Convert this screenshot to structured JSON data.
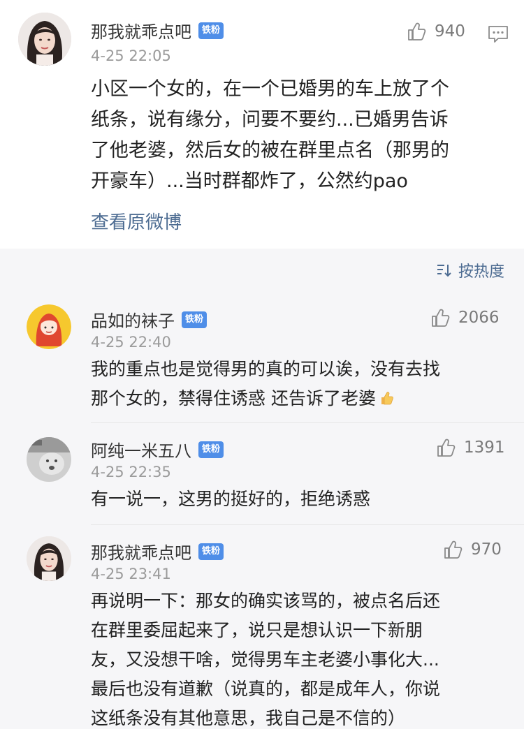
{
  "top_comment": {
    "username": "那我就乖点吧",
    "badge": "铁粉",
    "likes": "940",
    "timestamp": "4-25 22:05",
    "text_lines": [
      "小区一个女的，在一个已婚男的车上放了个",
      "纸条，说有缘分，问要不要约...已婚男告诉",
      "了他老婆，然后女的被在群里点名（那男的",
      "开豪车）...当时群都炸了，公然约pao"
    ],
    "view_original": "查看原微博",
    "more_icon": "comment-more-icon"
  },
  "sort": {
    "label": "按热度",
    "icon": "sort-icon"
  },
  "replies": [
    {
      "username": "品如的袜子",
      "badge": "铁粉",
      "likes": "2066",
      "timestamp": "4-25 22:40",
      "text_lines": [
        "我的重点也是觉得男的真的可以诶，没有去找",
        "那个女的，禁得住诱惑 还告诉了老婆"
      ],
      "trailing_emoji": "thumbs-up-emoji"
    },
    {
      "username": "阿纯一米五八",
      "badge": "铁粉",
      "likes": "1391",
      "timestamp": "4-25 22:35",
      "text_lines": [
        "有一说一，这男的挺好的，拒绝诱惑"
      ]
    },
    {
      "username": "那我就乖点吧",
      "badge": "铁粉",
      "likes": "970",
      "timestamp": "4-25 23:41",
      "text_lines": [
        "再说明一下：那女的确实该骂的，被点名后还",
        "在群里委屈起来了，说只是想认识一下新朋",
        "友，又没想干啥，觉得男车主老婆小事化大...",
        "最后也没有道歉（说真的，都是成年人，你说",
        "这纸条没有其他意思，我自己是不信的）"
      ]
    }
  ],
  "colors": {
    "link": "#4d6c92",
    "badge": "#4f8ee8",
    "timestamp": "#9b9b9b",
    "page_bg": "#f6f6f8"
  }
}
